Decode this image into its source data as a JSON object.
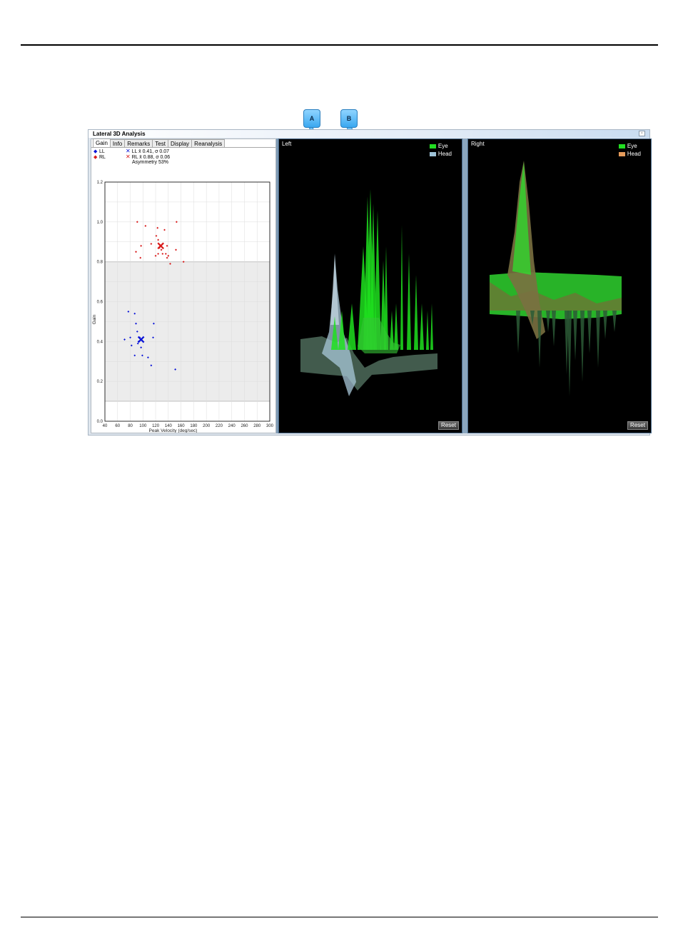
{
  "window": {
    "title": "Lateral 3D Analysis",
    "min_glyph": "▫"
  },
  "callouts": [
    {
      "label": "A"
    },
    {
      "label": "B"
    }
  ],
  "tabs": [
    "Gain",
    "Info",
    "Remarks",
    "Test",
    "Display",
    "Reanalysis"
  ],
  "legend": {
    "ll": "LL",
    "rl": "RL",
    "ll_stats": "LL x̄ 0.41, σ 0.07",
    "rl_stats": "RL x̄ 0.88, σ 0.06",
    "asymmetry": "Asymmetry 53%"
  },
  "colors": {
    "ll": "#0a14d8",
    "rl": "#d81a1a",
    "eye": "#22dd22",
    "head_left": "#9fc3d8",
    "head_right": "#e49a5a"
  },
  "chart_data": {
    "type": "scatter",
    "xlabel": "Peak Velocity (deg/sec)",
    "ylabel": "Gain",
    "xlim": [
      40,
      300
    ],
    "ylim": [
      0.0,
      1.2
    ],
    "xticks": [
      40,
      60,
      80,
      100,
      120,
      140,
      160,
      180,
      200,
      220,
      240,
      260,
      280,
      300
    ],
    "yticks": [
      "0.0",
      "0.2",
      "0.4",
      "0.6",
      "0.8",
      "1.0",
      "1.2"
    ],
    "normal_range": [
      0.1,
      0.8
    ],
    "series": [
      {
        "name": "LL",
        "color": "#0a14d8",
        "points": [
          [
            71,
            0.41
          ],
          [
            80,
            0.42
          ],
          [
            82,
            0.38
          ],
          [
            77,
            0.55
          ],
          [
            87,
            0.54
          ],
          [
            89,
            0.49
          ],
          [
            91,
            0.45
          ],
          [
            93,
            0.4
          ],
          [
            95,
            0.42
          ],
          [
            97,
            0.37
          ],
          [
            99,
            0.33
          ],
          [
            87,
            0.33
          ],
          [
            108,
            0.32
          ],
          [
            113,
            0.28
          ],
          [
            117,
            0.49
          ],
          [
            116,
            0.42
          ],
          [
            92,
            0.39
          ],
          [
            151,
            0.26
          ]
        ],
        "mean": [
          97,
          0.41
        ]
      },
      {
        "name": "RL",
        "color": "#d81a1a",
        "points": [
          [
            91,
            1.0
          ],
          [
            104,
            0.98
          ],
          [
            97,
            0.88
          ],
          [
            89,
            0.85
          ],
          [
            96,
            0.82
          ],
          [
            113,
            0.89
          ],
          [
            121,
            0.93
          ],
          [
            123,
            0.97
          ],
          [
            124,
            0.91
          ],
          [
            126,
            0.87
          ],
          [
            124,
            0.84
          ],
          [
            129,
            0.86
          ],
          [
            131,
            0.84
          ],
          [
            134,
            0.96
          ],
          [
            136,
            0.84
          ],
          [
            138,
            0.82
          ],
          [
            140,
            0.83
          ],
          [
            138,
            0.88
          ],
          [
            143,
            0.79
          ],
          [
            153,
            1.0
          ],
          [
            152,
            0.86
          ],
          [
            164,
            0.8
          ],
          [
            128,
            0.88
          ],
          [
            120,
            0.83
          ]
        ],
        "mean": [
          128,
          0.88
        ]
      }
    ]
  },
  "panels": {
    "left": {
      "title": "Left",
      "legend": [
        "Eye",
        "Head"
      ],
      "reset": "Reset"
    },
    "right": {
      "title": "Right",
      "legend": [
        "Eye",
        "Head"
      ],
      "reset": "Reset"
    }
  }
}
